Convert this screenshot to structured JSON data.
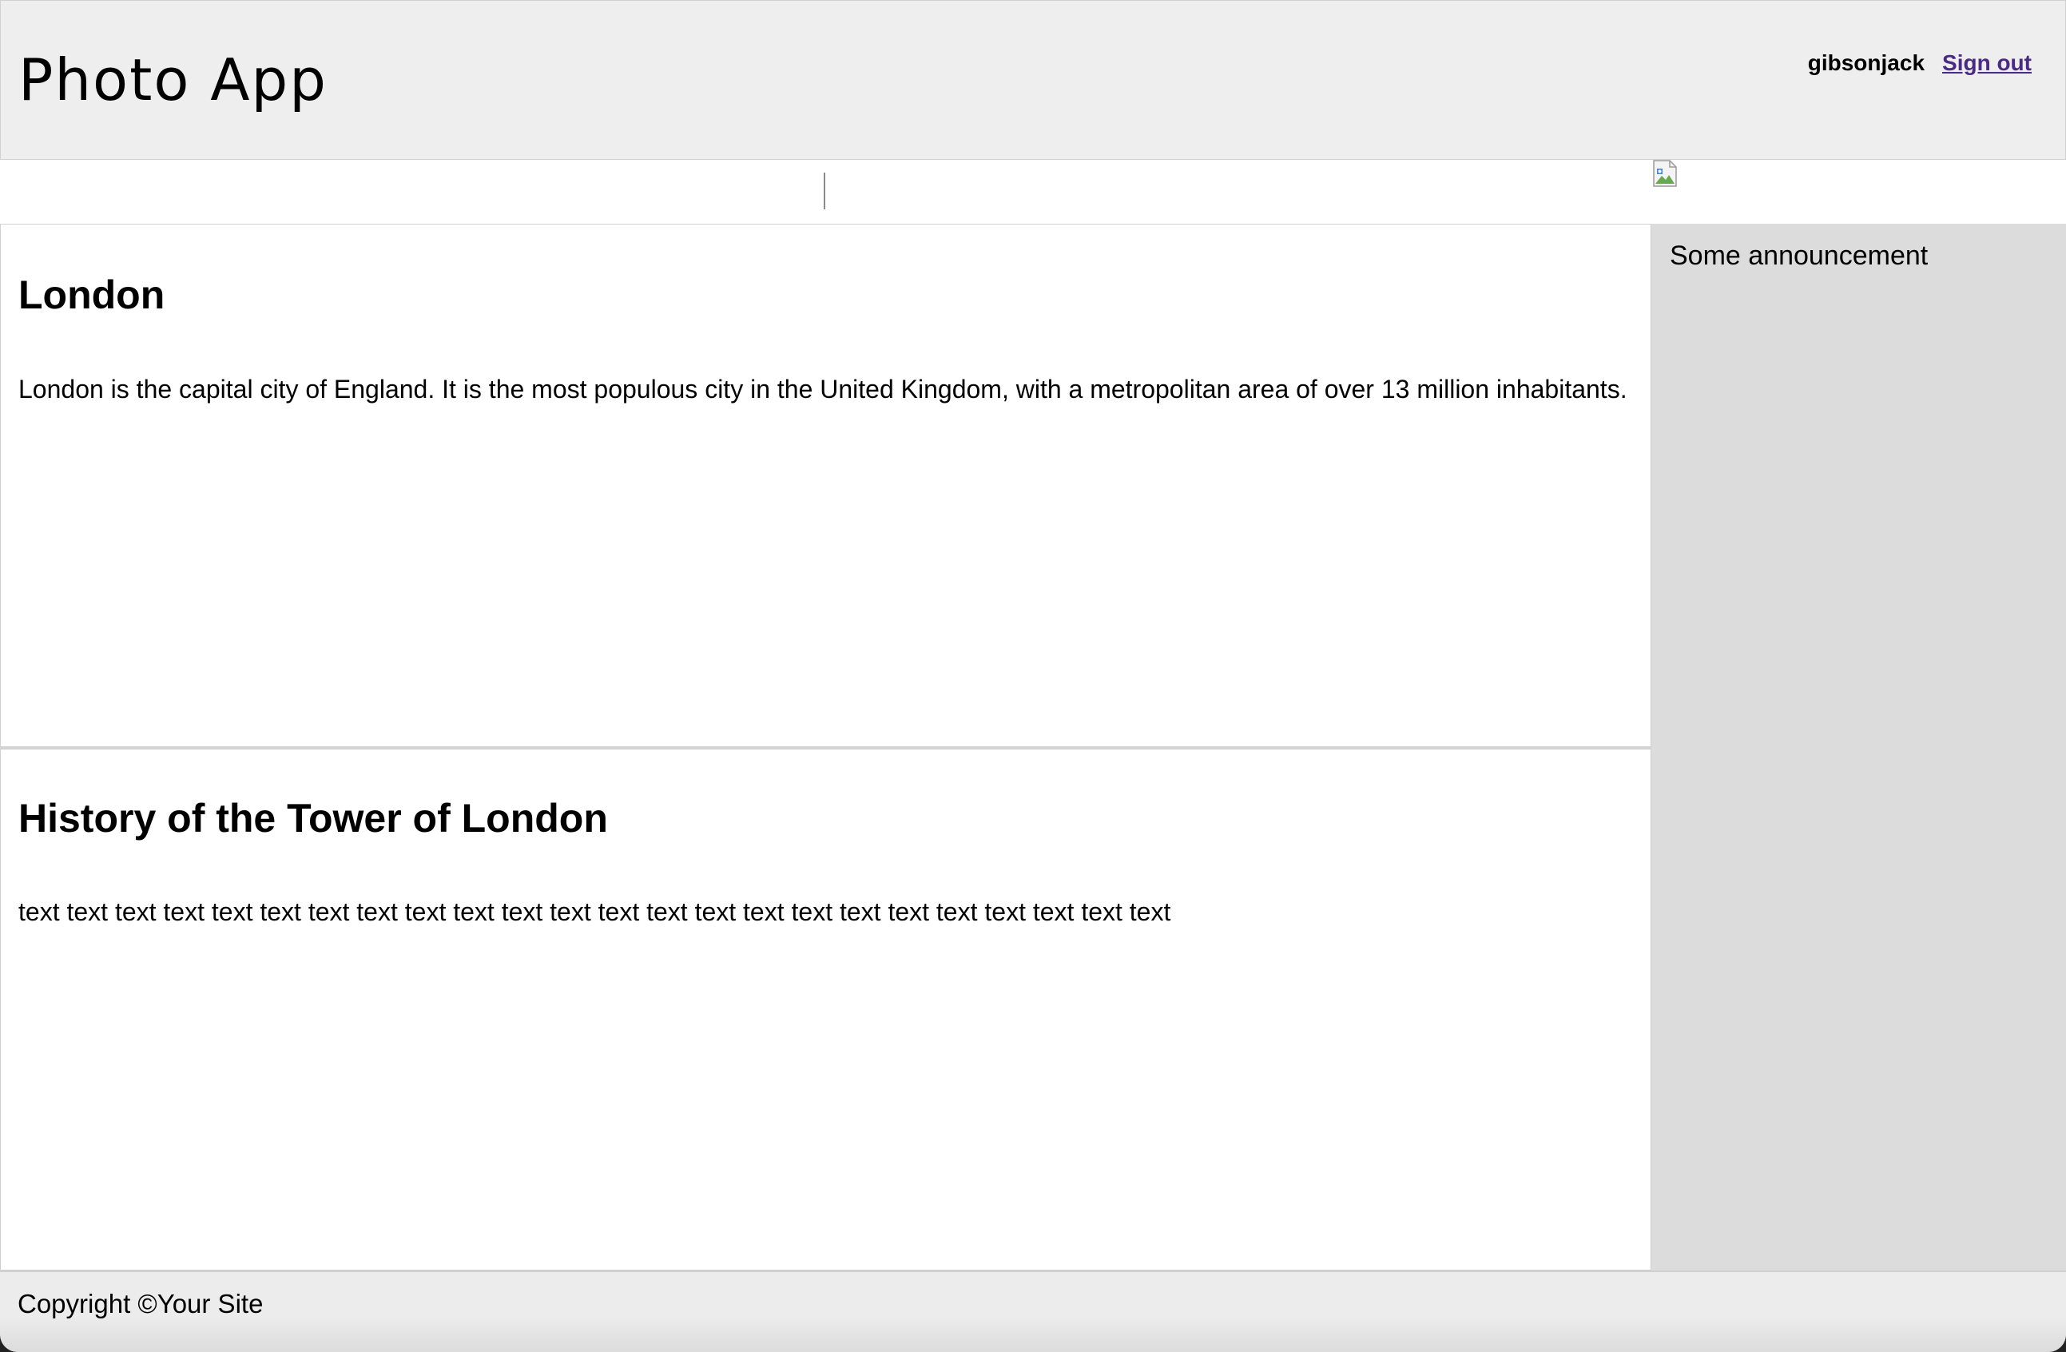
{
  "header": {
    "app_title": "Photo App",
    "username": "gibsonjack",
    "signout_label": "Sign out"
  },
  "nav": {
    "image_icon": "broken-image-icon"
  },
  "articles": [
    {
      "heading": "London",
      "text": "London is the capital city of England. It is the most populous city in the United Kingdom, with a metropolitan area of over 13 million inhabitants."
    },
    {
      "heading": "History of the Tower of London",
      "text": "text text text text text text text text text text text text text text text text text text text text text text text text"
    }
  ],
  "sidebar": {
    "announcement": "Some announcement"
  },
  "footer": {
    "copyright": "Copyright ©Your Site"
  },
  "colors": {
    "header_bg": "#eeeeee",
    "sidebar_bg": "#dcdcdc",
    "link": "#4b2a85"
  }
}
